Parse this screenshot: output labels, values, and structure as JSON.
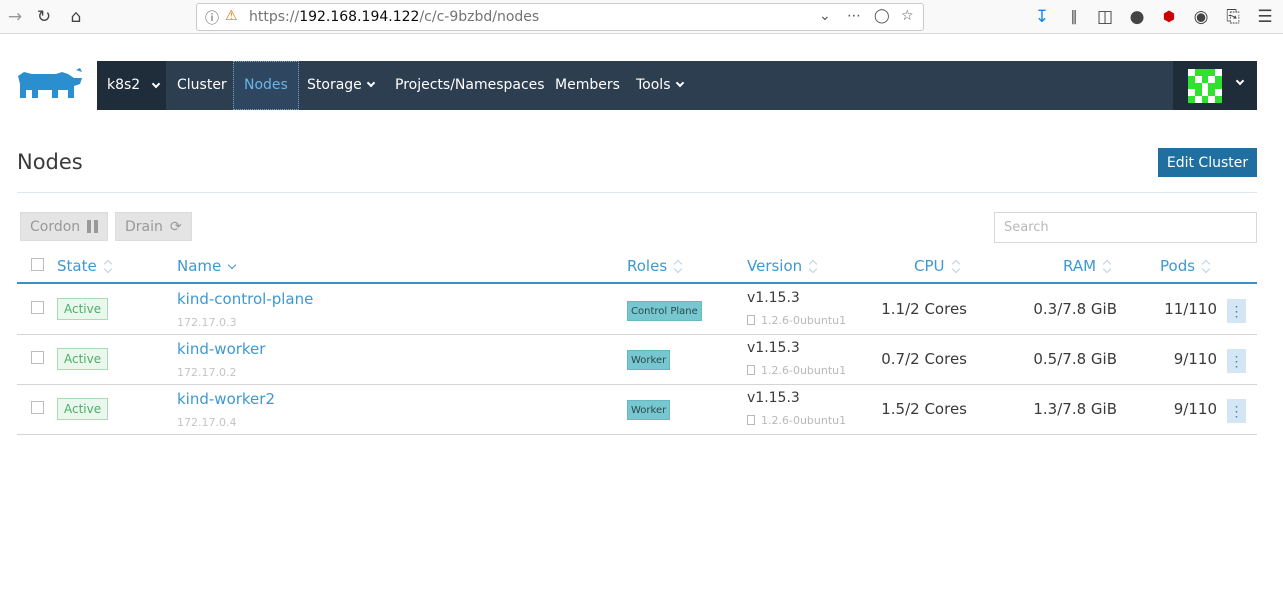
{
  "browser": {
    "url_prefix": "https://",
    "url_host": "192.168.194.122",
    "url_path": "/c/c-9bzbd/nodes"
  },
  "header": {
    "cluster_name": "k8s2",
    "nav": [
      "Cluster",
      "Nodes",
      "Storage",
      "Projects/Namespaces",
      "Members",
      "Tools"
    ],
    "active_nav": "Nodes"
  },
  "page": {
    "title": "Nodes",
    "edit_button": "Edit Cluster",
    "cordon_button": "Cordon",
    "drain_button": "Drain",
    "search_placeholder": "Search"
  },
  "table": {
    "columns": [
      "State",
      "Name",
      "Roles",
      "Version",
      "CPU",
      "RAM",
      "Pods"
    ],
    "rows": [
      {
        "state": "Active",
        "name": "kind-control-plane",
        "ip": "172.17.0.3",
        "role": "Control Plane",
        "version": "v1.15.3",
        "docker": "1.2.6-0ubuntu1",
        "cpu": "1.1/2 Cores",
        "ram": "0.3/7.8 GiB",
        "pods": "11/110"
      },
      {
        "state": "Active",
        "name": "kind-worker",
        "ip": "172.17.0.2",
        "role": "Worker",
        "version": "v1.15.3",
        "docker": "1.2.6-0ubuntu1",
        "cpu": "0.7/2 Cores",
        "ram": "0.5/7.8 GiB",
        "pods": "9/110"
      },
      {
        "state": "Active",
        "name": "kind-worker2",
        "ip": "172.17.0.4",
        "role": "Worker",
        "version": "v1.15.3",
        "docker": "1.2.6-0ubuntu1",
        "cpu": "1.5/2 Cores",
        "ram": "1.3/7.8 GiB",
        "pods": "9/110"
      }
    ]
  },
  "colors": {
    "header_bg": "#2c3e50",
    "accent": "#3d98d3",
    "primary_button": "#1f6fa1",
    "active_green": "#4caf6a",
    "role_teal": "#76c7cf"
  }
}
